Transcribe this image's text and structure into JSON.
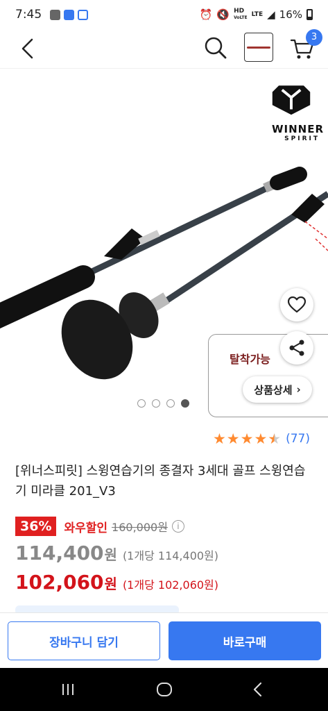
{
  "status_bar": {
    "time": "7:45",
    "network": "HD",
    "network_sub": "VoLTE",
    "signal": "LTE",
    "battery": "16%"
  },
  "app_bar": {
    "cart_count": "3"
  },
  "product_image": {
    "brand_name": "WINNER",
    "brand_sub": "SPIRIT",
    "detach_label": "탈착가능",
    "detail_button": "상품상세",
    "carousel_total": 4,
    "carousel_active": 4
  },
  "rating": {
    "stars": 4.5,
    "review_count": "(77)",
    "star_color": "#ff8a30"
  },
  "product": {
    "title": "[위너스피릿] 스윙연습기의 종결자 3세대 골프 스윙연습기 미라클 201_V3",
    "discount_rate": "36%",
    "discount_label": "와우할인",
    "original_price": "160,000원",
    "price": "114,400",
    "price_unit_won": "원",
    "price_per_unit": "(1개당 114,400원)",
    "wow_price": "102,060",
    "wow_price_per_unit": "(1개당 102,060원)"
  },
  "actions": {
    "add_to_cart": "장바구니 담기",
    "buy_now": "바로구매"
  },
  "colors": {
    "accent": "#3778f0",
    "sale": "#d3131a"
  }
}
